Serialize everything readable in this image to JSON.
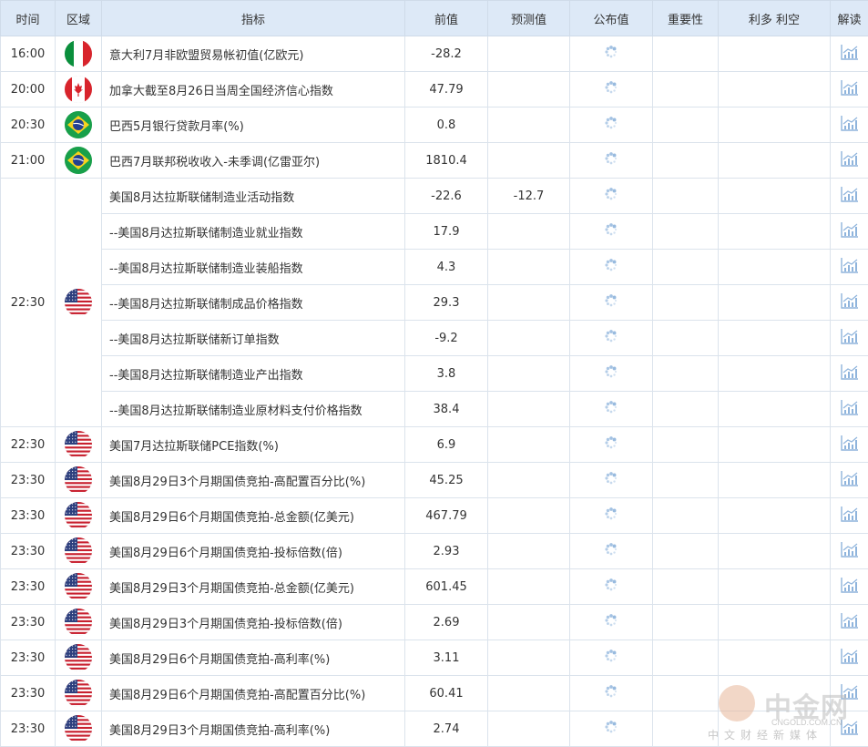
{
  "headers": [
    "时间",
    "区域",
    "指标",
    "前值",
    "预测值",
    "公布值",
    "重要性",
    "利多 利空",
    "解读"
  ],
  "rows": [
    {
      "time": "16:00",
      "region": "italy",
      "indicator": "意大利7月非欧盟贸易帐初值(亿欧元)",
      "prev": "-28.2",
      "forecast": "",
      "actual": ""
    },
    {
      "time": "20:00",
      "region": "canada",
      "indicator": "加拿大截至8月26日当周全国经济信心指数",
      "prev": "47.79",
      "forecast": "",
      "actual": ""
    },
    {
      "time": "20:30",
      "region": "brazil",
      "indicator": "巴西5月银行贷款月率(%)",
      "prev": "0.8",
      "forecast": "",
      "actual": ""
    },
    {
      "time": "21:00",
      "region": "brazil",
      "indicator": "巴西7月联邦税收收入-未季调(亿雷亚尔)",
      "prev": "1810.4",
      "forecast": "",
      "actual": ""
    }
  ],
  "group": {
    "time": "22:30",
    "region": "usa",
    "rows": [
      {
        "indicator": "美国8月达拉斯联储制造业活动指数",
        "prev": "-22.6",
        "forecast": "-12.7"
      },
      {
        "indicator": "--美国8月达拉斯联储制造业就业指数",
        "prev": "17.9",
        "forecast": ""
      },
      {
        "indicator": "--美国8月达拉斯联储制造业装船指数",
        "prev": "4.3",
        "forecast": ""
      },
      {
        "indicator": "--美国8月达拉斯联储制成品价格指数",
        "prev": "29.3",
        "forecast": ""
      },
      {
        "indicator": "--美国8月达拉斯联储新订单指数",
        "prev": "-9.2",
        "forecast": ""
      },
      {
        "indicator": "--美国8月达拉斯联储制造业产出指数",
        "prev": "3.8",
        "forecast": ""
      },
      {
        "indicator": "--美国8月达拉斯联储制造业原材料支付价格指数",
        "prev": "38.4",
        "forecast": ""
      }
    ]
  },
  "rows2": [
    {
      "time": "22:30",
      "region": "usa",
      "indicator": "美国7月达拉斯联储PCE指数(%)",
      "prev": "6.9"
    },
    {
      "time": "23:30",
      "region": "usa",
      "indicator": "美国8月29日3个月期国债竞拍-高配置百分比(%)",
      "prev": "45.25"
    },
    {
      "time": "23:30",
      "region": "usa",
      "indicator": "美国8月29日6个月期国债竞拍-总金额(亿美元)",
      "prev": "467.79"
    },
    {
      "time": "23:30",
      "region": "usa",
      "indicator": "美国8月29日6个月期国债竞拍-投标倍数(倍)",
      "prev": "2.93"
    },
    {
      "time": "23:30",
      "region": "usa",
      "indicator": "美国8月29日3个月期国债竞拍-总金额(亿美元)",
      "prev": "601.45"
    },
    {
      "time": "23:30",
      "region": "usa",
      "indicator": "美国8月29日3个月期国债竞拍-投标倍数(倍)",
      "prev": "2.69"
    },
    {
      "time": "23:30",
      "region": "usa",
      "indicator": "美国8月29日6个月期国债竞拍-高利率(%)",
      "prev": "3.11"
    },
    {
      "time": "23:30",
      "region": "usa",
      "indicator": "美国8月29日6个月期国债竞拍-高配置百分比(%)",
      "prev": "60.41"
    },
    {
      "time": "23:30",
      "region": "usa",
      "indicator": "美国8月29日3个月期国债竞拍-高利率(%)",
      "prev": "2.74"
    }
  ],
  "watermark": {
    "name": "中金网",
    "url": "CNGOLD.COM.CN",
    "tagline": "中文财经新媒体"
  },
  "icons": {
    "actual": "loading-spinner-icon",
    "interpret": "chart-icon"
  },
  "colors": {
    "header_bg": "#dde9f7",
    "border": "#dbe3ec",
    "icon": "#8fb4dc"
  }
}
